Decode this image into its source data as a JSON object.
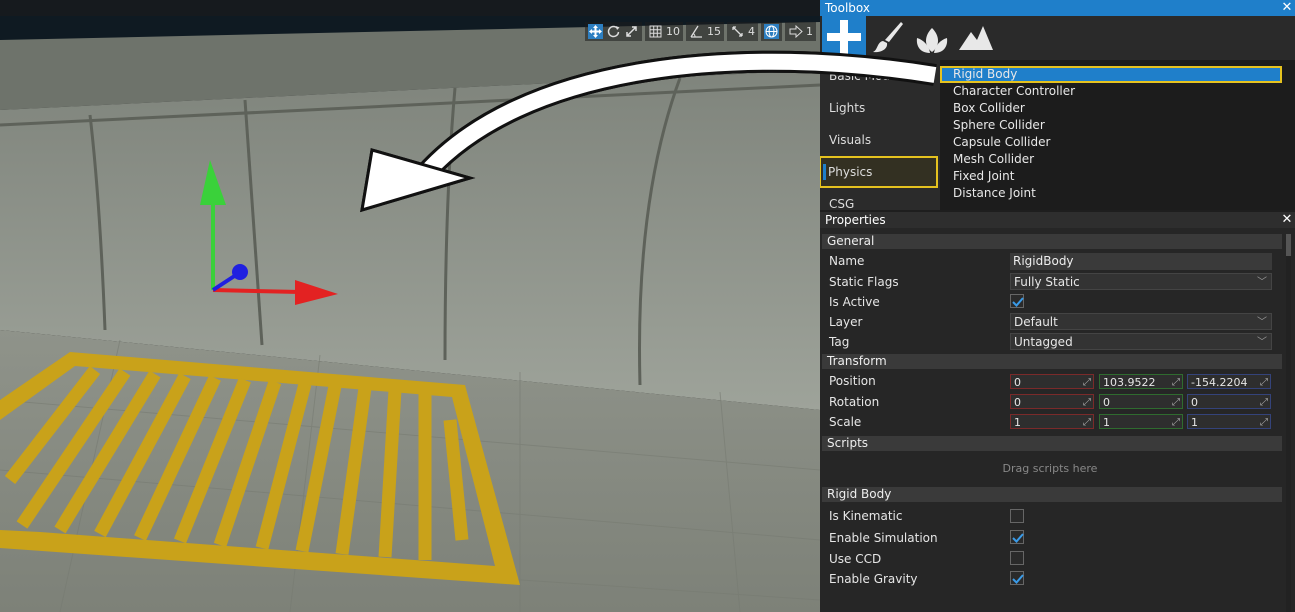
{
  "viewport": {
    "toolbar": {
      "grid_size": "10",
      "angle_snap": "15",
      "scale_snap": "4",
      "speed": "1"
    }
  },
  "toolbox": {
    "title": "Toolbox",
    "tabs": [
      {
        "icon": "plus-icon"
      },
      {
        "icon": "paint-brush-icon"
      },
      {
        "icon": "foliage-icon"
      },
      {
        "icon": "terrain-icon"
      }
    ],
    "categories": [
      "Basic Models",
      "Lights",
      "Visuals",
      "Physics",
      "CSG"
    ],
    "active_category": "Physics",
    "items": [
      "Rigid Body",
      "Character Controller",
      "Box Collider",
      "Sphere Collider",
      "Capsule Collider",
      "Mesh Collider",
      "Fixed Joint",
      "Distance Joint"
    ],
    "active_item": "Rigid Body"
  },
  "properties": {
    "title": "Properties",
    "general": {
      "header": "General",
      "name_label": "Name",
      "name_value": "RigidBody",
      "static_flags_label": "Static Flags",
      "static_flags_value": "Fully Static",
      "is_active_label": "Is Active",
      "is_active": true,
      "layer_label": "Layer",
      "layer_value": "Default",
      "tag_label": "Tag",
      "tag_value": "Untagged"
    },
    "transform": {
      "header": "Transform",
      "position_label": "Position",
      "position": [
        "0",
        "103.9522",
        "-154.2204"
      ],
      "rotation_label": "Rotation",
      "rotation": [
        "0",
        "0",
        "0"
      ],
      "scale_label": "Scale",
      "scale": [
        "1",
        "1",
        "1"
      ]
    },
    "scripts": {
      "header": "Scripts",
      "drop_hint": "Drag scripts here"
    },
    "rigid_body": {
      "header": "Rigid Body",
      "is_kinematic_label": "Is Kinematic",
      "is_kinematic": false,
      "enable_simulation_label": "Enable Simulation",
      "enable_simulation": true,
      "use_ccd_label": "Use CCD",
      "use_ccd": false,
      "enable_gravity_label": "Enable Gravity",
      "enable_gravity": true
    }
  },
  "colors": {
    "accent": "#1f7fca",
    "highlight": "#e5c21f",
    "panel": "#262626"
  }
}
